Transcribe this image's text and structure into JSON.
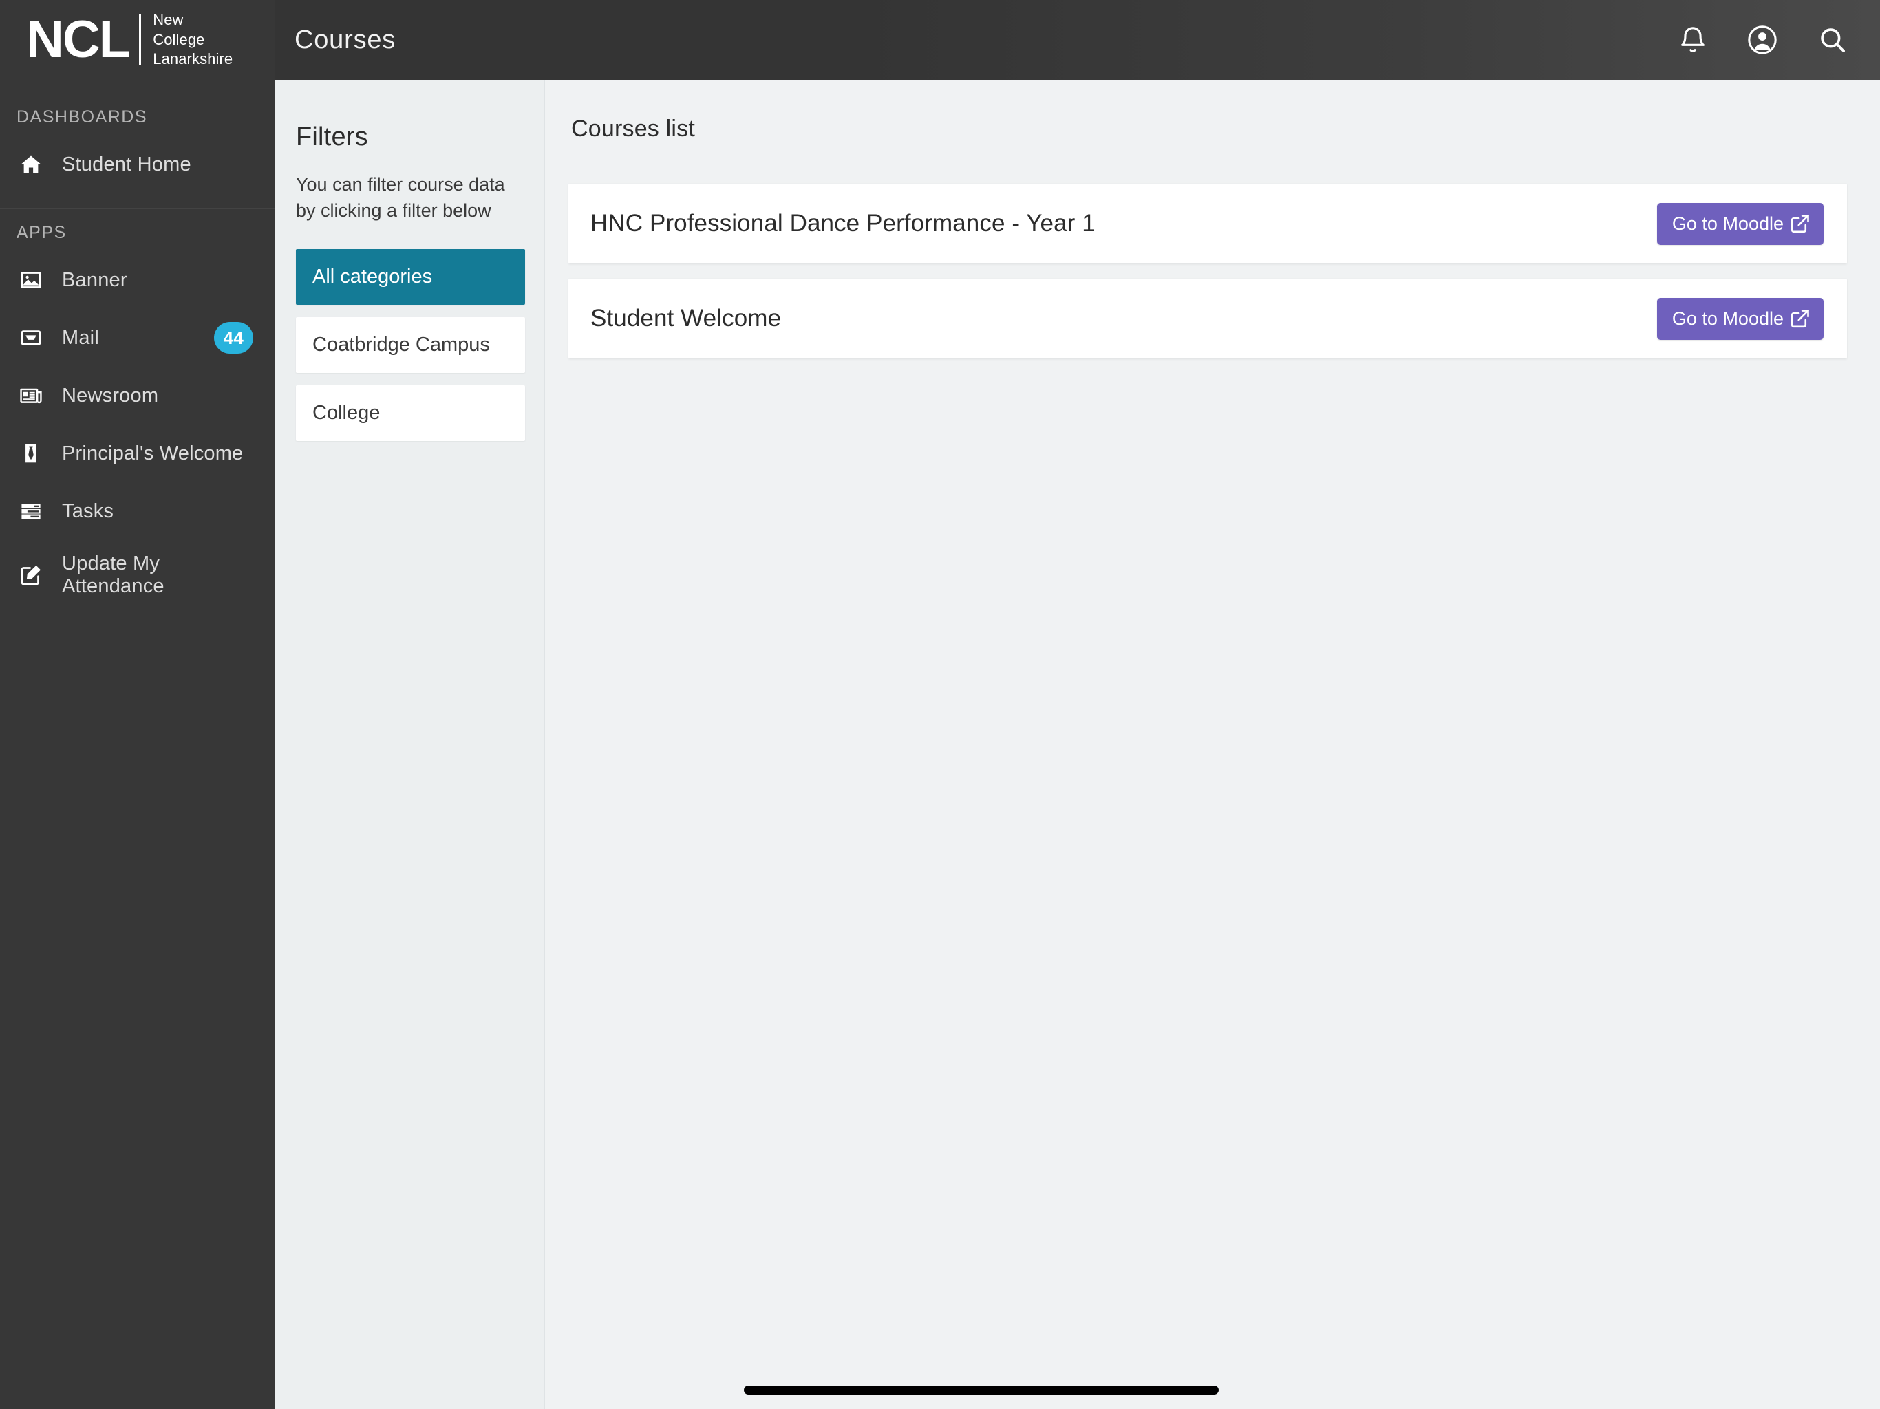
{
  "header": {
    "logo": {
      "mark": "NCL",
      "words": "New\nCollege\nLanarkshire"
    },
    "title": "Courses",
    "icons": [
      {
        "name": "notifications-bell-icon",
        "label": "Notifications"
      },
      {
        "name": "user-account-icon",
        "label": "Account"
      },
      {
        "name": "search-icon",
        "label": "Search"
      }
    ]
  },
  "sidebar": {
    "groups": [
      {
        "label": "DASHBOARDS",
        "items": [
          {
            "label": "Student Home",
            "icon": "home-icon",
            "badge": null
          }
        ]
      },
      {
        "label": "APPS",
        "items": [
          {
            "label": "Banner",
            "icon": "image-icon",
            "badge": null
          },
          {
            "label": "Mail",
            "icon": "inbox-icon",
            "badge": "44"
          },
          {
            "label": "Newsroom",
            "icon": "newspaper-icon",
            "badge": null
          },
          {
            "label": "Principal's Welcome",
            "icon": "necktie-icon",
            "badge": null
          },
          {
            "label": "Tasks",
            "icon": "tasks-list-icon",
            "badge": null
          },
          {
            "label": "Update My Attendance",
            "icon": "edit-pencil-icon",
            "badge": null
          }
        ]
      }
    ]
  },
  "filters": {
    "title": "Filters",
    "description": "You can filter course data by clicking a filter below",
    "options": [
      {
        "label": "All categories",
        "active": true
      },
      {
        "label": "Coatbridge Campus",
        "active": false
      },
      {
        "label": "College",
        "active": false
      }
    ]
  },
  "main": {
    "title": "Courses list",
    "courses": [
      {
        "name": "HNC Professional Dance Performance - Year 1",
        "action_label": "Go to Moodle"
      },
      {
        "name": "Student Welcome",
        "action_label": "Go to Moodle"
      }
    ]
  },
  "colors": {
    "sidebar_bg": "#373737",
    "header_bg": "#343434",
    "filter_panel_bg": "#eceff0",
    "main_bg": "#f0f2f3",
    "accent_teal": "#147b96",
    "accent_purple": "#6f60bd",
    "badge_blue": "#29b3dd",
    "card_bg": "#ffffff"
  }
}
